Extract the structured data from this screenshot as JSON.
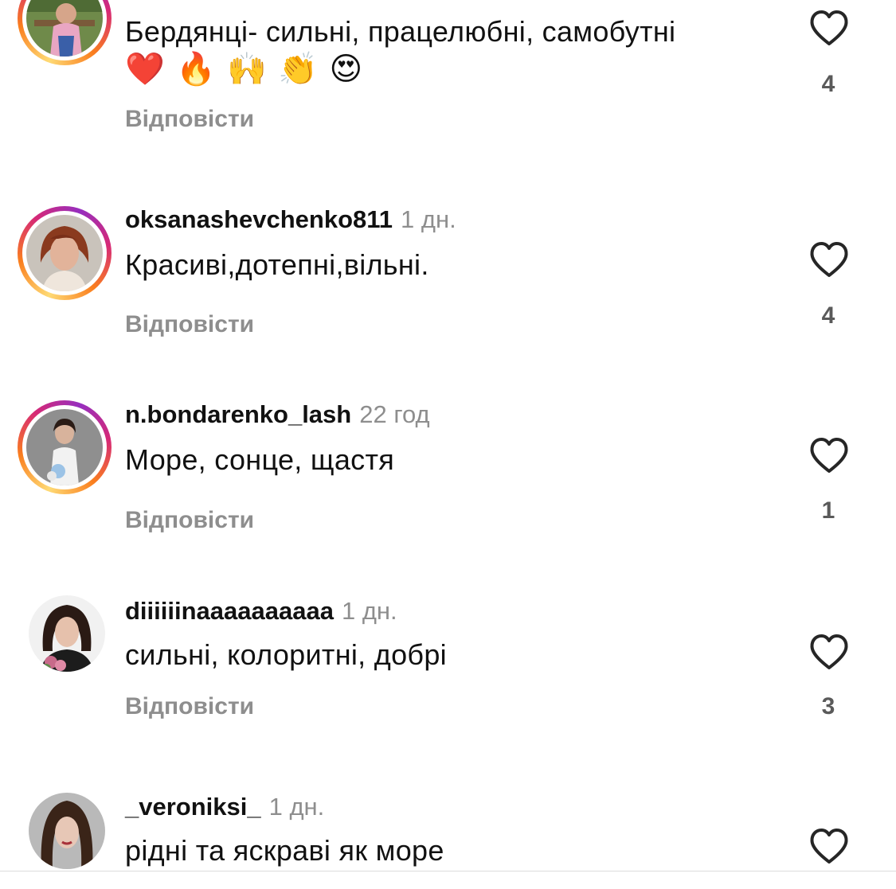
{
  "comments": [
    {
      "username": "",
      "time": "",
      "text": "Бердянці- сильні, працелюбні, самобутні",
      "emojis": [
        "❤️",
        "🔥",
        "🙌",
        "👏",
        "😍"
      ],
      "reply_label": "Відповісти",
      "likes": "4"
    },
    {
      "username": "oksanashevchenko811",
      "time": "1 дн.",
      "text": "Красиві,дотепні,вільні.",
      "reply_label": "Відповісти",
      "likes": "4"
    },
    {
      "username": "n.bondarenko_lash",
      "time": "22 год",
      "text": "Море, сонце, щастя",
      "reply_label": "Відповісти",
      "likes": "1"
    },
    {
      "username": "diiiiiinaaaaaaaaaa",
      "time": "1 дн.",
      "text": "сильні, колоритні, добрі",
      "reply_label": "Відповісти",
      "likes": "3"
    },
    {
      "username": "_veroniksi_",
      "time": "1 дн.",
      "text": "рідні та яскраві як море",
      "reply_label": "",
      "likes": ""
    }
  ],
  "icons": {
    "like": "heart-outline-icon",
    "avatar_ring_colors": [
      "#feda75",
      "#fa7e1e",
      "#d62976",
      "#962fbf"
    ]
  },
  "colors": {
    "text": "#111111",
    "secondary": "#8e8e8e",
    "likes": "#5a5a5a"
  }
}
